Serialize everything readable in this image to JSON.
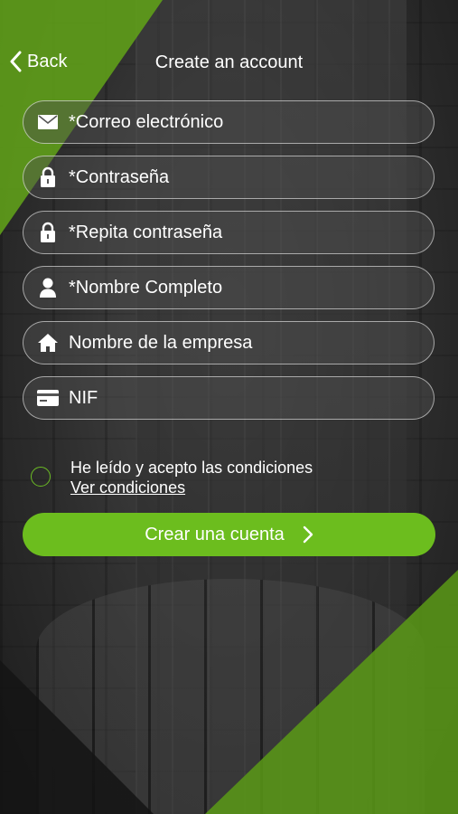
{
  "header": {
    "back_label": "Back",
    "title": "Create an account"
  },
  "form": {
    "fields": [
      {
        "name": "email",
        "icon": "envelope-icon",
        "placeholder": "*Correo electrónico"
      },
      {
        "name": "password",
        "icon": "lock-icon",
        "placeholder": "*Contraseña"
      },
      {
        "name": "repeat-password",
        "icon": "lock-icon",
        "placeholder": "*Repita contraseña"
      },
      {
        "name": "full-name",
        "icon": "user-icon",
        "placeholder": "*Nombre Completo"
      },
      {
        "name": "company-name",
        "icon": "home-icon",
        "placeholder": "Nombre de la empresa"
      },
      {
        "name": "nif",
        "icon": "card-icon",
        "placeholder": "NIF"
      }
    ],
    "terms_text": "He leído y acepto las condiciones",
    "terms_link": "Ver condiciones",
    "submit_label": "Crear una cuenta"
  },
  "colors": {
    "accent": "#6cbd1e",
    "background_green": "#5f9f1a"
  }
}
